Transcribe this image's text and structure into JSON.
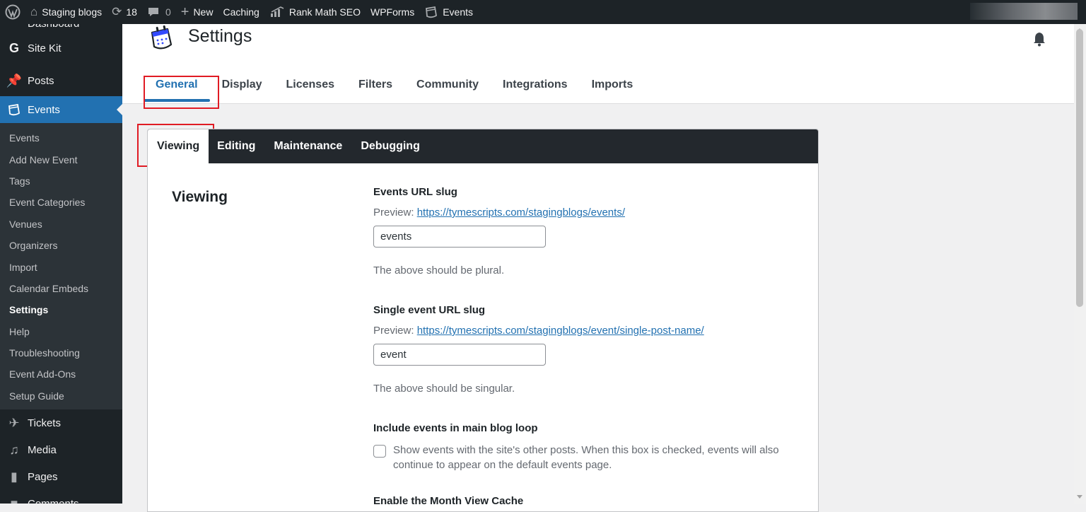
{
  "adminbar": {
    "site_name": "Staging blogs",
    "updates_count": "18",
    "comments_count": "0",
    "new_label": "New",
    "caching_label": "Caching",
    "rankmath_label": "Rank Math SEO",
    "wpforms_label": "WPForms",
    "events_label": "Events"
  },
  "sidebar": {
    "partial_top": "Dashboard",
    "items": {
      "sitekit": "Site Kit",
      "posts": "Posts",
      "events": "Events",
      "tickets": "Tickets",
      "media": "Media",
      "pages": "Pages",
      "comments": "Comments"
    },
    "submenu": [
      "Events",
      "Add New Event",
      "Tags",
      "Event Categories",
      "Venues",
      "Organizers",
      "Import",
      "Calendar Embeds",
      "Settings",
      "Help",
      "Troubleshooting",
      "Event Add-Ons",
      "Setup Guide"
    ],
    "current_submenu": "Settings"
  },
  "page": {
    "title": "Settings",
    "main_tabs": [
      "General",
      "Display",
      "Licenses",
      "Filters",
      "Community",
      "Integrations",
      "Imports"
    ],
    "active_main_tab": "General",
    "sub_tabs": [
      "Viewing",
      "Editing",
      "Maintenance",
      "Debugging"
    ],
    "active_sub_tab": "Viewing",
    "section_title": "Viewing"
  },
  "fields": {
    "events_slug": {
      "label": "Events URL slug",
      "preview_prefix": "Preview: ",
      "preview_url": "https://tymescripts.com/stagingblogs/events/",
      "value": "events",
      "help": "The above should be plural."
    },
    "single_slug": {
      "label": "Single event URL slug",
      "preview_prefix": "Preview: ",
      "preview_url": "https://tymescripts.com/stagingblogs/event/single-post-name/",
      "value": "event",
      "help": "The above should be singular."
    },
    "blog_loop": {
      "label": "Include events in main blog loop",
      "description": "Show events with the site's other posts. When this box is checked, events will also continue to appear on the default events page.",
      "checked": false
    },
    "month_cache": {
      "label": "Enable the Month View Cache"
    }
  },
  "colors": {
    "admin_dark": "#1d2327",
    "accent": "#2271b1",
    "highlight_box": "#e01b24"
  }
}
